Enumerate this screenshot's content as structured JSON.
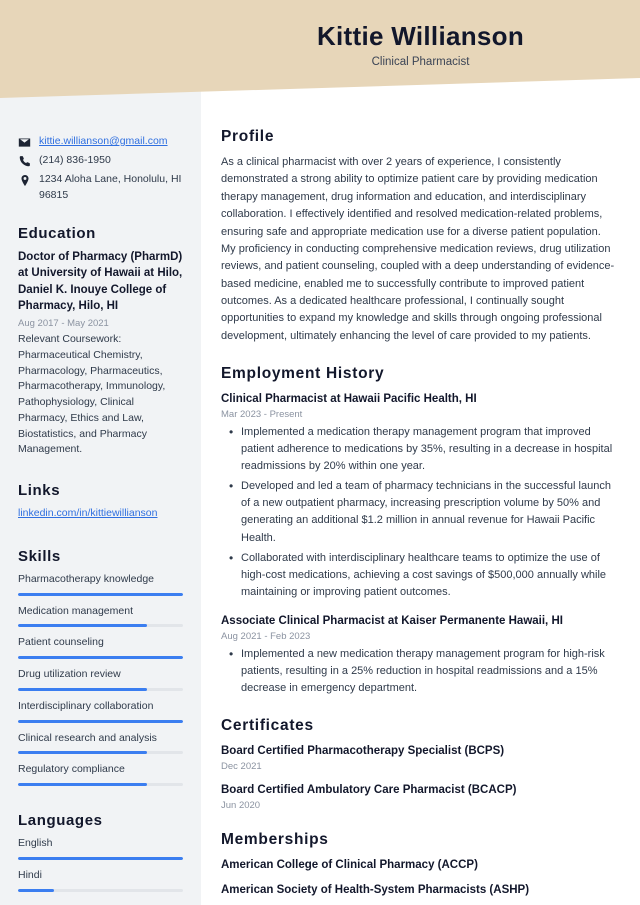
{
  "header": {
    "name": "Kittie Willianson",
    "role": "Clinical Pharmacist",
    "bg_color": "#E7D6B9"
  },
  "theme": {
    "sidebar_bg": "#F1F3F5",
    "accent": "#3B7EF0",
    "link": "#2F6FE0",
    "heading": "#12172B",
    "body": "#2F3A4A",
    "muted": "#8B93A1"
  },
  "sidebar": {
    "contact": {
      "email": "kittie.willianson@gmail.com",
      "phone": "(214) 836-1950",
      "address": "1234 Aloha Lane, Honolulu, HI 96815"
    },
    "education": {
      "heading": "Education",
      "items": [
        {
          "title": "Doctor of Pharmacy (PharmD) at University of Hawaii at Hilo, Daniel K. Inouye College of Pharmacy, Hilo, HI",
          "date": "Aug 2017 - May 2021",
          "description": "Relevant Coursework: Pharmaceutical Chemistry, Pharmacology, Pharmaceutics, Pharmacotherapy, Immunology, Pathophysiology, Clinical Pharmacy, Ethics and Law, Biostatistics, and Pharmacy Management."
        }
      ]
    },
    "links": {
      "heading": "Links",
      "items": [
        {
          "label": "linkedin.com/in/kittiewillianson"
        }
      ]
    },
    "skills": {
      "heading": "Skills",
      "items": [
        {
          "label": "Pharmacotherapy knowledge",
          "level": 100
        },
        {
          "label": "Medication management",
          "level": 78
        },
        {
          "label": "Patient counseling",
          "level": 100
        },
        {
          "label": "Drug utilization review",
          "level": 78
        },
        {
          "label": "Interdisciplinary collaboration",
          "level": 100
        },
        {
          "label": "Clinical research and analysis",
          "level": 78
        },
        {
          "label": "Regulatory compliance",
          "level": 78
        }
      ]
    },
    "languages": {
      "heading": "Languages",
      "items": [
        {
          "label": "English",
          "level": 100
        },
        {
          "label": "Hindi",
          "level": 22
        }
      ]
    }
  },
  "main": {
    "profile": {
      "heading": "Profile",
      "text": "As a clinical pharmacist with over 2 years of experience, I consistently demonstrated a strong ability to optimize patient care by providing medication therapy management, drug information and education, and interdisciplinary collaboration. I effectively identified and resolved medication-related problems, ensuring safe and appropriate medication use for a diverse patient population. My proficiency in conducting comprehensive medication reviews, drug utilization reviews, and patient counseling, coupled with a deep understanding of evidence-based medicine, enabled me to successfully contribute to improved patient outcomes. As a dedicated healthcare professional, I continually sought opportunities to expand my knowledge and skills through ongoing professional development, ultimately enhancing the level of care provided to my patients."
    },
    "employment": {
      "heading": "Employment History",
      "jobs": [
        {
          "title": "Clinical Pharmacist at Hawaii Pacific Health, HI",
          "date": "Mar 2023 - Present",
          "bullets": [
            "Implemented a medication therapy management program that improved patient adherence to medications by 35%, resulting in a decrease in hospital readmissions by 20% within one year.",
            "Developed and led a team of pharmacy technicians in the successful launch of a new outpatient pharmacy, increasing prescription volume by 50% and generating an additional $1.2 million in annual revenue for Hawaii Pacific Health.",
            "Collaborated with interdisciplinary healthcare teams to optimize the use of high-cost medications, achieving a cost savings of $500,000 annually while maintaining or improving patient outcomes."
          ]
        },
        {
          "title": "Associate Clinical Pharmacist at Kaiser Permanente Hawaii, HI",
          "date": "Aug 2021 - Feb 2023",
          "bullets": [
            "Implemented a new medication therapy management program for high-risk patients, resulting in a 25% reduction in hospital readmissions and a 15% decrease in emergency department."
          ]
        }
      ]
    },
    "certificates": {
      "heading": "Certificates",
      "items": [
        {
          "title": "Board Certified Pharmacotherapy Specialist (BCPS)",
          "date": "Dec 2021"
        },
        {
          "title": "Board Certified Ambulatory Care Pharmacist (BCACP)",
          "date": "Jun 2020"
        }
      ]
    },
    "memberships": {
      "heading": "Memberships",
      "items": [
        {
          "title": "American College of Clinical Pharmacy (ACCP)"
        },
        {
          "title": "American Society of Health-System Pharmacists (ASHP)"
        }
      ]
    }
  }
}
